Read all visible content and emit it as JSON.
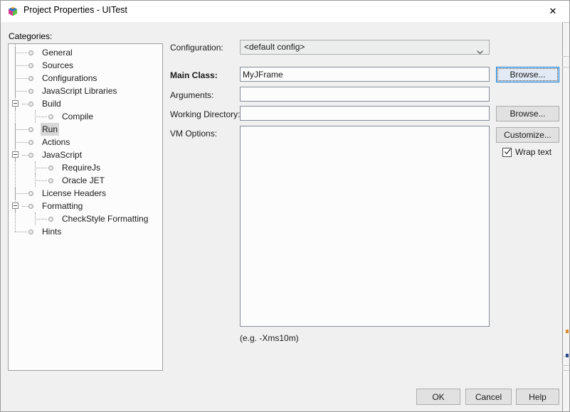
{
  "window": {
    "title": "Project Properties - UITest",
    "app_icon": "netbeans-cube-icon",
    "close_label": "✕"
  },
  "categories": {
    "label": "Categories:",
    "items": [
      {
        "label": "General",
        "depth": 0,
        "expander": "none"
      },
      {
        "label": "Sources",
        "depth": 0,
        "expander": "none"
      },
      {
        "label": "Configurations",
        "depth": 0,
        "expander": "none"
      },
      {
        "label": "JavaScript Libraries",
        "depth": 0,
        "expander": "none"
      },
      {
        "label": "Build",
        "depth": 0,
        "expander": "minus"
      },
      {
        "label": "Compile",
        "depth": 1,
        "expander": "none"
      },
      {
        "label": "Run",
        "depth": 0,
        "expander": "none",
        "selected": true
      },
      {
        "label": "Actions",
        "depth": 0,
        "expander": "none"
      },
      {
        "label": "JavaScript",
        "depth": 0,
        "expander": "minus"
      },
      {
        "label": "RequireJs",
        "depth": 1,
        "expander": "none"
      },
      {
        "label": "Oracle JET",
        "depth": 1,
        "expander": "none"
      },
      {
        "label": "License Headers",
        "depth": 0,
        "expander": "none"
      },
      {
        "label": "Formatting",
        "depth": 0,
        "expander": "minus"
      },
      {
        "label": "CheckStyle Formatting",
        "depth": 1,
        "expander": "none"
      },
      {
        "label": "Hints",
        "depth": 0,
        "expander": "none"
      }
    ]
  },
  "form": {
    "configuration": {
      "label": "Configuration:",
      "value": "<default config>",
      "arrow_icon": "chevron-down-icon"
    },
    "main_class": {
      "label": "Main Class:",
      "value": "MyJFrame",
      "placeholder": "",
      "browse_label": "Browse..."
    },
    "arguments": {
      "label": "Arguments:",
      "value": "",
      "placeholder": ""
    },
    "working_directory": {
      "label": "Working Directory:",
      "value": "",
      "placeholder": "",
      "browse_label": "Browse..."
    },
    "vm_options": {
      "label": "VM Options:",
      "value": "",
      "placeholder": "",
      "hint": "(e.g. -Xms10m)",
      "customize_label": "Customize...",
      "wrap_text_label": "Wrap text",
      "wrap_text_checked": true,
      "check_icon": "checkmark-icon"
    }
  },
  "footer": {
    "ok_label": "OK",
    "cancel_label": "Cancel",
    "help_label": "Help"
  },
  "colors": {
    "dialog_bg": "#f0f0f0",
    "field_bg": "#fbfcfb",
    "field_border": "#878f99",
    "button_bg": "#e1e1e1",
    "button_border": "#adadad",
    "focus_blue": "#0078d7",
    "selection_gray": "#d8d8d8",
    "title_bar_bg": "#ffffff"
  }
}
